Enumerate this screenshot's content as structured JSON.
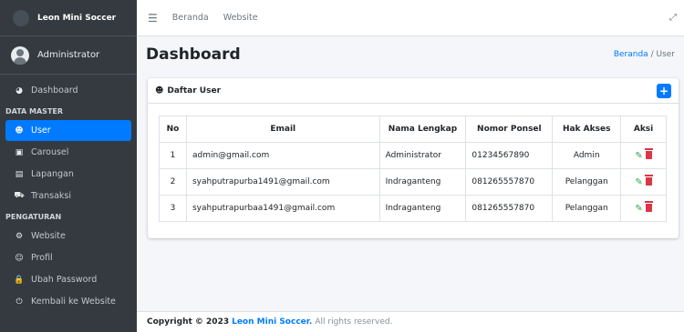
{
  "app": {
    "brand": "Leon Mini Soccer"
  },
  "user": {
    "name": "Administrator"
  },
  "sidebar": {
    "items": [
      {
        "label": "Dashboard",
        "icon": "tachometer-icon",
        "glyph": "◕"
      },
      {
        "header": "DATA MASTER"
      },
      {
        "label": "User",
        "icon": "users-icon",
        "glyph": "☻",
        "active": true
      },
      {
        "label": "Carousel",
        "icon": "image-icon",
        "glyph": "▣"
      },
      {
        "label": "Lapangan",
        "icon": "building-icon",
        "glyph": "▤"
      },
      {
        "label": "Transaksi",
        "icon": "cart-icon",
        "glyph": "⛟"
      },
      {
        "header": "PENGATURAN"
      },
      {
        "label": "Website",
        "icon": "cogs-icon",
        "glyph": "⚙"
      },
      {
        "label": "Profil",
        "icon": "user-cog-icon",
        "glyph": "☺"
      },
      {
        "label": "Ubah Password",
        "icon": "lock-icon",
        "glyph": "🔒"
      },
      {
        "label": "Kembali ke Website",
        "icon": "power-icon",
        "glyph": "⏻"
      }
    ]
  },
  "topnav": {
    "links": [
      "Beranda",
      "Website"
    ]
  },
  "header": {
    "title": "Dashboard",
    "crumb_home": "Beranda",
    "crumb_sep": "/",
    "crumb_current": "User"
  },
  "card": {
    "title": "Daftar User",
    "columns": [
      "No",
      "Email",
      "Nama Lengkap",
      "Nomor Ponsel",
      "Hak Akses",
      "Aksi"
    ],
    "rows": [
      {
        "no": "1",
        "email": "admin@gmail.com",
        "name": "Administrator",
        "phone": "01234567890",
        "role": "Admin"
      },
      {
        "no": "2",
        "email": "syahputrapurba1491@gmail.com",
        "name": "Indraganteng",
        "phone": "081265557870",
        "role": "Pelanggan"
      },
      {
        "no": "3",
        "email": "syahputrapurbaa1491@gmail.com",
        "name": "Indraganteng",
        "phone": "081265557870",
        "role": "Pelanggan"
      }
    ]
  },
  "footer": {
    "prefix": "Copyright © 2023",
    "brand": "Leon Mini Soccer.",
    "suffix": "All rights reserved."
  },
  "colors": {
    "primary": "#007bff",
    "sidebar": "#343a40",
    "edit": "#28a745",
    "delete": "#dc3545"
  }
}
